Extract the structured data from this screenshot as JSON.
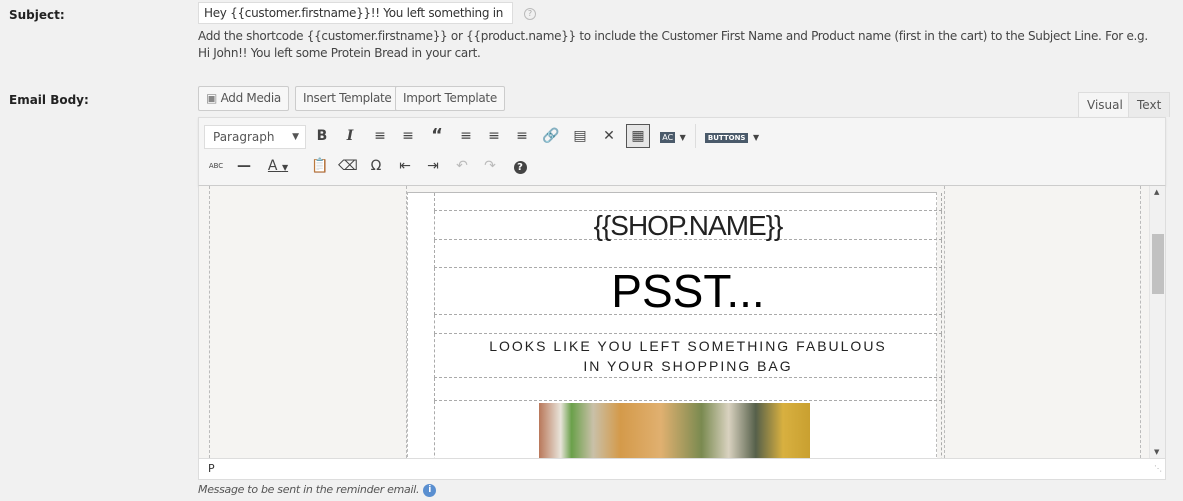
{
  "subject": {
    "label": "Subject:",
    "value": "Hey {{customer.firstname}}!! You left something in your cart",
    "help_icon": "question-circle-icon",
    "description": "Add the shortcode {{customer.firstname}} or {{product.name}} to include the Customer First Name and Product name (first in the cart) to the Subject Line. For e.g. Hi John!! You left some Protein Bread in your cart."
  },
  "body": {
    "label": "Email Body:",
    "add_media": "Add Media",
    "insert_template": "Insert Template",
    "import_template": "Import Template",
    "tab_visual": "Visual",
    "tab_text": "Text"
  },
  "toolbar": {
    "format": "Paragraph",
    "buttons_label": "BUTTONS",
    "ac_label": "AC",
    "strike_label": "ABC"
  },
  "email": {
    "shop_name": "{{SHOP.NAME}}",
    "headline": "PSST...",
    "line1": "LOOKS LIKE YOU LEFT SOMETHING FABULOUS",
    "line2": "IN YOUR SHOPPING BAG"
  },
  "status_path": "P",
  "note": "Message to be sent in the reminder email."
}
